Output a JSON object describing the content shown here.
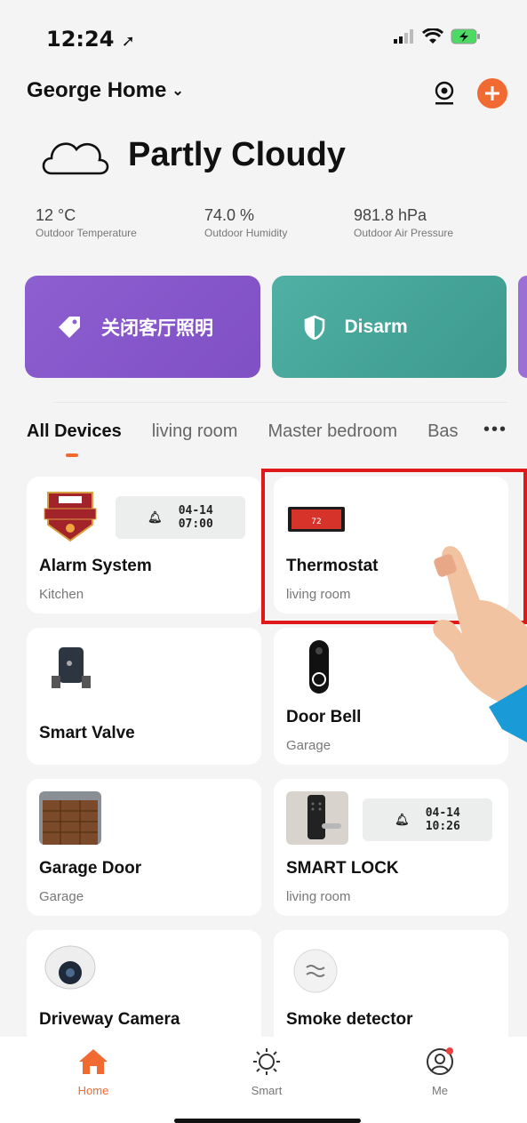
{
  "status": {
    "time": "12:24"
  },
  "header": {
    "home_name": "George Home"
  },
  "weather": {
    "condition": "Partly Cloudy",
    "stats": [
      {
        "value": "12 °C",
        "label": "Outdoor Temperature"
      },
      {
        "value": "74.0 %",
        "label": "Outdoor Humidity"
      },
      {
        "value": "981.8 hPa",
        "label": "Outdoor Air Pressure"
      }
    ]
  },
  "scenes": [
    {
      "label": "关闭客厅照明"
    },
    {
      "label": "Disarm"
    }
  ],
  "tabs": {
    "items": [
      "All Devices",
      "living room",
      "Master bedroom",
      "Bas"
    ],
    "more": "•••"
  },
  "devices": [
    {
      "name": "Alarm System",
      "room": "Kitchen",
      "badge_date": "04-14",
      "badge_time": "07:00"
    },
    {
      "name": "Thermostat",
      "room": "living room",
      "display": "72"
    },
    {
      "name": "Smart Valve",
      "room": ""
    },
    {
      "name": "Door Bell",
      "room": "Garage"
    },
    {
      "name": "Garage Door",
      "room": "Garage"
    },
    {
      "name": "SMART LOCK",
      "room": "living room",
      "badge_date": "04-14",
      "badge_time": "10:26"
    },
    {
      "name": "Driveway Camera",
      "room": ""
    },
    {
      "name": "Smoke detector",
      "room": ""
    }
  ],
  "nav": [
    {
      "label": "Home"
    },
    {
      "label": "Smart"
    },
    {
      "label": "Me"
    }
  ],
  "colors": {
    "accent": "#f06a32",
    "highlight": "#e0181a"
  }
}
